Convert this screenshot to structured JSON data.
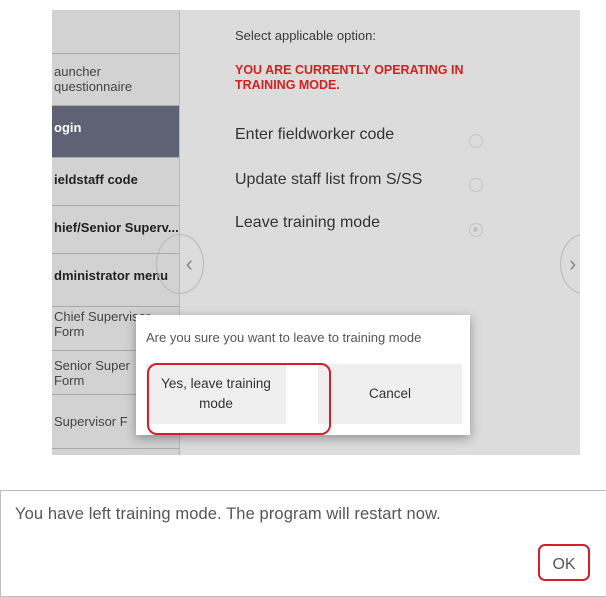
{
  "sidebar": {
    "items": [
      {
        "label": "auncher\nquestionnaire"
      },
      {
        "label": "ogin"
      },
      {
        "label": "ieldstaff code"
      },
      {
        "label": "hief/Senior Superv..."
      },
      {
        "label": "dministrator menu"
      },
      {
        "label": "Chief Supervisor\nForm"
      },
      {
        "label": "Senior Super\nForm"
      },
      {
        "label": "Supervisor F"
      }
    ]
  },
  "main": {
    "prompt": "Select applicable option:",
    "warning": "YOU ARE CURRENTLY OPERATING IN TRAINING MODE.",
    "options": [
      {
        "label": "Enter fieldworker code",
        "selected": false
      },
      {
        "label": "Update staff list from S/SS",
        "selected": false
      },
      {
        "label": "Leave training mode",
        "selected": true
      }
    ],
    "nav": {
      "prev_icon": "chevron-left-icon",
      "next_icon": "chevron-right-icon"
    }
  },
  "dialog": {
    "message": "Are you sure you want to leave to training mode",
    "confirm_label": "Yes, leave training\nmode",
    "cancel_label": "Cancel"
  },
  "notice": {
    "message": "You have left training mode. The program will restart now.",
    "ok_label": "OK"
  },
  "colors": {
    "highlight": "#d41e2f",
    "warning": "#d32020",
    "active_item": "#5f6275"
  }
}
